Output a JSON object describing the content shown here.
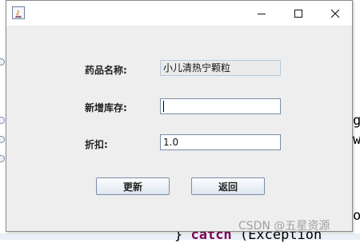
{
  "background": {
    "code_line_1": "g",
    "code_line_2": "w",
    "code_line_3": "o",
    "code_line_catch_kw": "catch",
    "code_line_catch_rest": " (Exception",
    "code_line_catch_prefix": "} "
  },
  "window": {
    "title": "",
    "controls": {
      "minimize_icon": "minimize-icon",
      "maximize_icon": "maximize-icon",
      "close_icon": "close-icon"
    }
  },
  "form": {
    "drug_name_label": "药品名称:",
    "drug_name_value": "小儿清热宁颗粒",
    "new_stock_label": "新增库存:",
    "new_stock_value": "",
    "discount_label": "折扣:",
    "discount_value": "1.0"
  },
  "buttons": {
    "update_label": "更新",
    "back_label": "返回"
  },
  "watermark": "CSDN @五星资源",
  "colors": {
    "dialog_bg": "#eeeeee",
    "field_border": "#7a8ca6",
    "keyword": "#7f0055"
  }
}
